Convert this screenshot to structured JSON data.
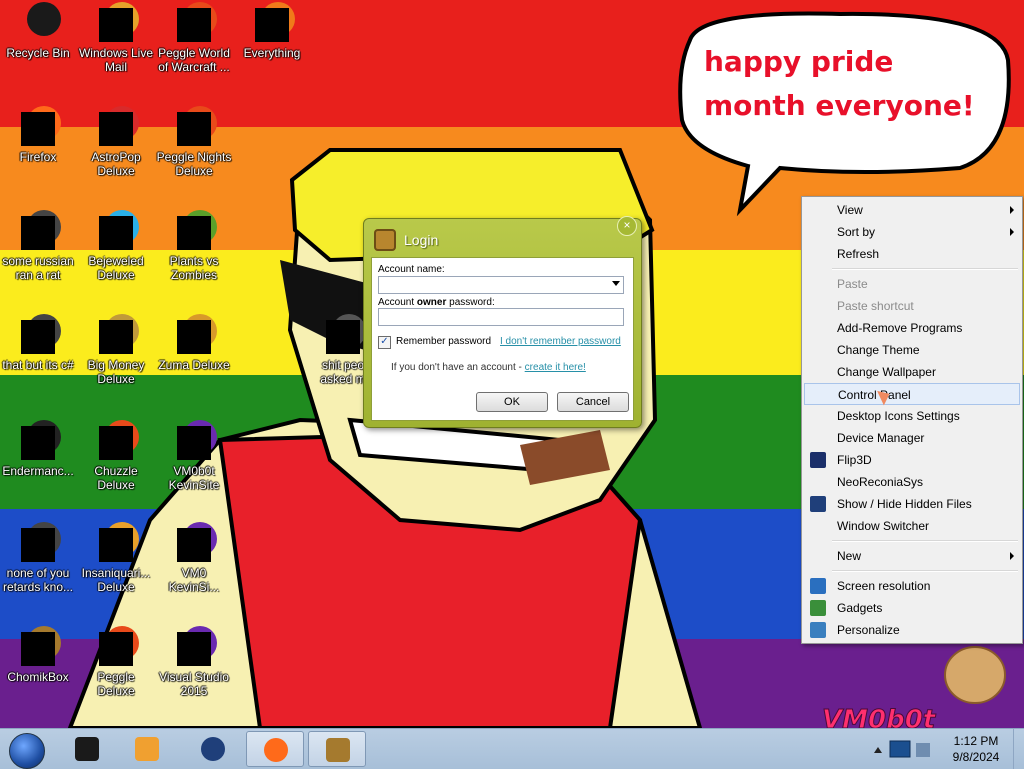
{
  "wallpaper": {
    "stripes": [
      "#e8201c",
      "#f78a1e",
      "#fbec1d",
      "#1f8b1f",
      "#1d4dc8",
      "#6a1f8e"
    ],
    "bubble_text": "happy pride month everyone!",
    "watermark": "VM0b0t"
  },
  "desktop_icons": [
    {
      "label": "Recycle Bin",
      "icon": "recycle-bin-icon"
    },
    {
      "label": "Windows Live Mail",
      "icon": "mail-icon"
    },
    {
      "label": "Peggle World of Warcraft ...",
      "icon": "peggle-icon"
    },
    {
      "label": "Everything",
      "icon": "search-icon"
    },
    {
      "label": "Firefox",
      "icon": "firefox-icon"
    },
    {
      "label": "AstroPop Deluxe",
      "icon": "astropop-icon"
    },
    {
      "label": "Peggle Nights Deluxe",
      "icon": "peggle-icon"
    },
    {
      "label": "some russian ran a rat",
      "icon": "app-icon"
    },
    {
      "label": "Bejeweled Deluxe",
      "icon": "gem-icon"
    },
    {
      "label": "Plants vs Zombies",
      "icon": "plant-icon"
    },
    {
      "label": "that but its c#",
      "icon": "app-icon"
    },
    {
      "label": "Big Money Deluxe",
      "icon": "money-bag-icon"
    },
    {
      "label": "Zuma Deluxe",
      "icon": "frog-icon"
    },
    {
      "label": "shit peo asked m",
      "icon": "folder-icon"
    },
    {
      "label": "Endermanc...",
      "icon": "console-icon"
    },
    {
      "label": "Chuzzle Deluxe",
      "icon": "chuzzle-icon"
    },
    {
      "label": "VM0b0t KevinSite",
      "icon": "visual-studio-icon"
    },
    {
      "label": "none of you retards kno...",
      "icon": "app-icon"
    },
    {
      "label": "Insaniquari... Deluxe",
      "icon": "fish-icon"
    },
    {
      "label": "VM0 KevinSi...",
      "icon": "visual-studio-icon"
    },
    {
      "label": "ChomikBox",
      "icon": "hamster-icon"
    },
    {
      "label": "Peggle Deluxe",
      "icon": "peggle-icon"
    },
    {
      "label": "Visual Studio 2015",
      "icon": "visual-studio-icon"
    }
  ],
  "login": {
    "title": "Login",
    "account_name_label": "Account name:",
    "account_name_value": "",
    "owner_password_label_1": "Account ",
    "owner_password_label_bold": "owner",
    "owner_password_label_2": " password:",
    "password_value": "",
    "remember_label": "Remember password",
    "remember_checked": true,
    "forgot_link": "I don't remember password",
    "no_account_text": "If you don't have an account - ",
    "create_link": "create it here!",
    "ok": "OK",
    "cancel": "Cancel",
    "close": "×"
  },
  "context_menu": [
    {
      "label": "View",
      "submenu": true
    },
    {
      "label": "Sort by",
      "submenu": true
    },
    {
      "label": "Refresh"
    },
    {
      "sep": true
    },
    {
      "label": "Paste",
      "disabled": true
    },
    {
      "label": "Paste shortcut",
      "disabled": true
    },
    {
      "label": "Add-Remove Programs"
    },
    {
      "label": "Change Theme"
    },
    {
      "label": "Change Wallpaper"
    },
    {
      "label": "Control Panel",
      "highlight": true
    },
    {
      "label": "Desktop Icons Settings"
    },
    {
      "label": "Device Manager"
    },
    {
      "label": "Flip3D",
      "icon": "flip3d-icon"
    },
    {
      "label": "NeoReconiaSys"
    },
    {
      "label": "Show / Hide Hidden Files",
      "icon": "globe-icon"
    },
    {
      "label": "Window Switcher"
    },
    {
      "sep": true
    },
    {
      "label": "New",
      "submenu": true
    },
    {
      "sep": true
    },
    {
      "label": "Screen resolution",
      "icon": "monitor-icon"
    },
    {
      "label": "Gadgets",
      "icon": "gadgets-icon"
    },
    {
      "label": "Personalize",
      "icon": "personalize-icon"
    }
  ],
  "taskbar": {
    "pinned": [
      {
        "name": "terminal",
        "icon": "terminal-icon",
        "color": "#1a1a1a"
      },
      {
        "name": "media-player",
        "icon": "media-player-icon",
        "color": "#f0a030"
      },
      {
        "name": "globe",
        "icon": "globe-icon",
        "color": "#1f3f7a"
      },
      {
        "name": "firefox",
        "icon": "firefox-icon",
        "color": "#ff6a1a"
      },
      {
        "name": "chomikbox",
        "icon": "hamster-icon",
        "color": "#a57a2e"
      }
    ],
    "time": "1:12 PM",
    "date": "9/8/2024"
  }
}
